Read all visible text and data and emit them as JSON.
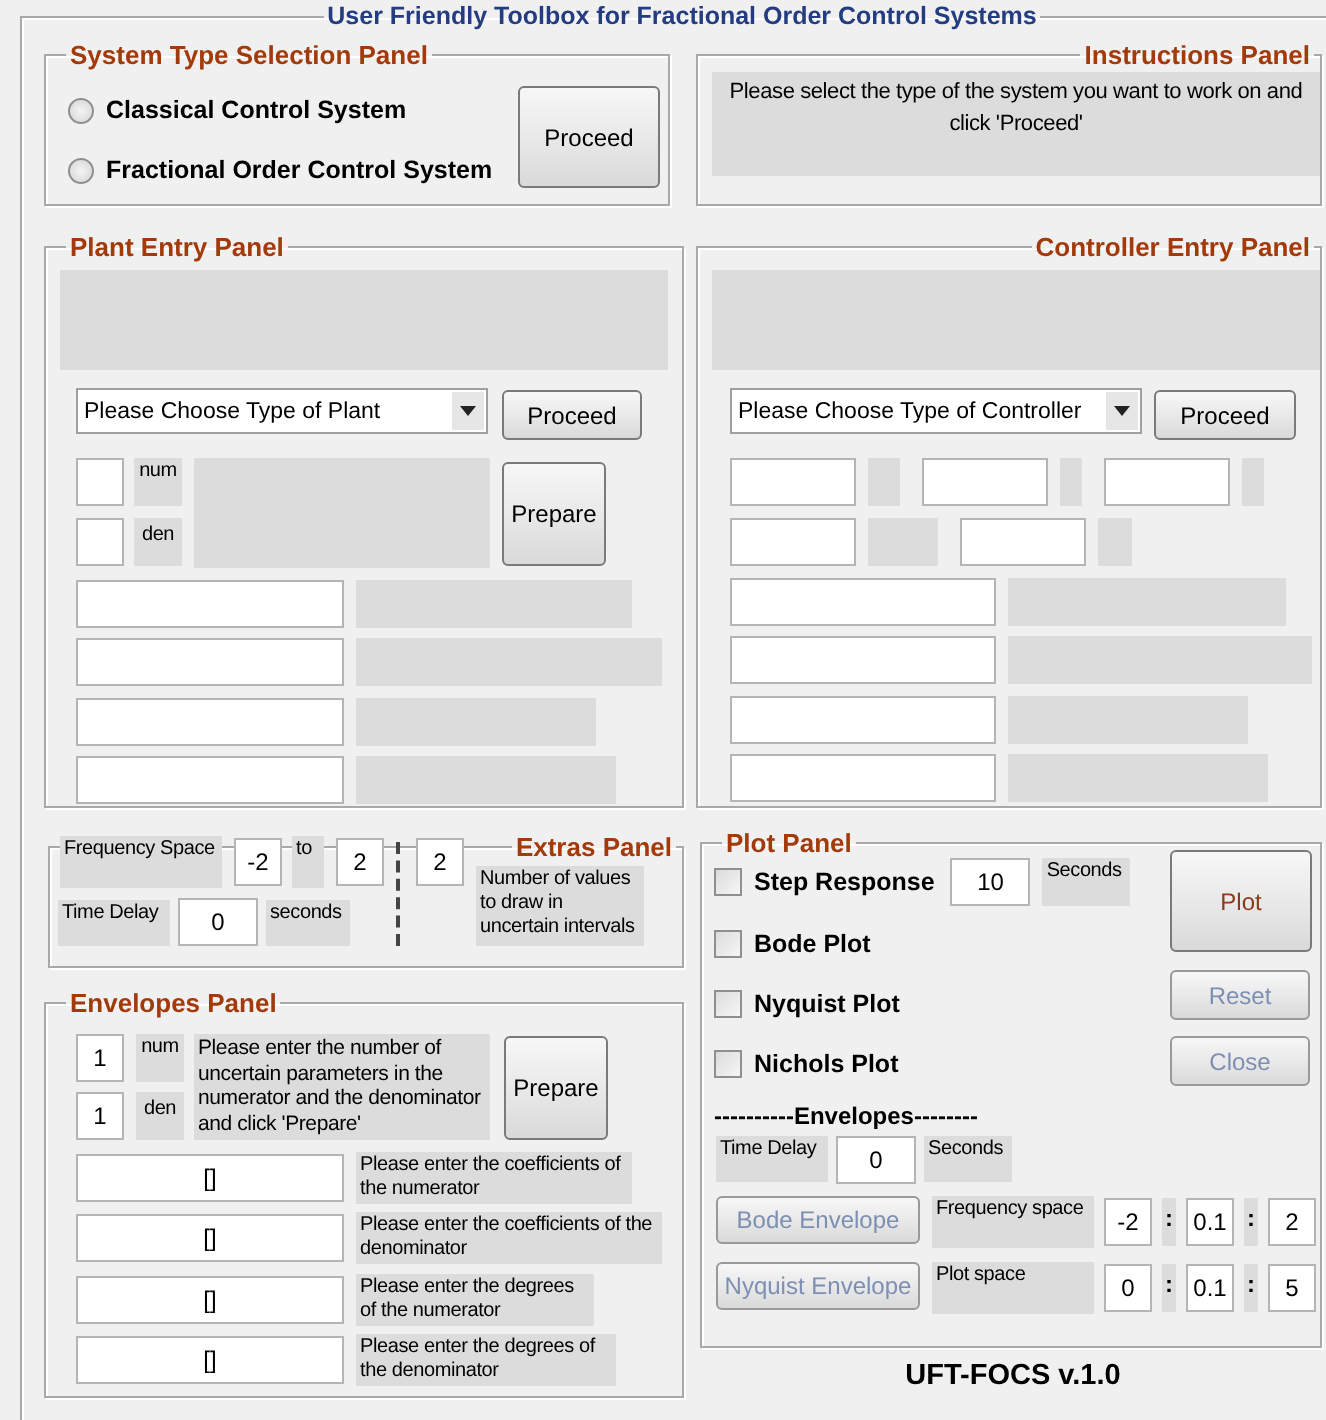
{
  "window": {
    "title": "User Friendly Toolbox for Fractional Order Control Systems"
  },
  "system_type_panel": {
    "title": "System Type Selection Panel",
    "options": [
      {
        "label": "Classical Control System",
        "selected": false
      },
      {
        "label": "Fractional Order Control System",
        "selected": false
      }
    ],
    "button": "Proceed"
  },
  "instructions_panel": {
    "title": "Instructions Panel",
    "text": "Please select the type of the system you want to work on and click 'Proceed'"
  },
  "plant_panel": {
    "title": "Plant Entry Panel",
    "dropdown": {
      "value": "Please Choose Type of Plant"
    },
    "proceed_button": "Proceed",
    "num_label": "num",
    "den_label": "den",
    "prepare_button": "Prepare"
  },
  "controller_panel": {
    "title": "Controller Entry Panel",
    "dropdown": {
      "value": "Please Choose Type of Controller"
    },
    "proceed_button": "Proceed"
  },
  "extras_panel": {
    "title": "Extras Panel",
    "frequency_label": "Frequency Space",
    "frequency_from": "-2",
    "to_label": "to",
    "frequency_to": "2",
    "time_delay_label": "Time Delay",
    "time_delay": "0",
    "seconds_label": "seconds",
    "value_count": "2",
    "value_count_label": "Number of values to draw in uncertain intervals"
  },
  "envelopes_panel": {
    "title": "Envelopes Panel",
    "num": "1",
    "num_label": "num",
    "den": "1",
    "den_label": "den",
    "instructions": "Please enter the number of uncertain parameters in the numerator and the denominator and click 'Prepare'",
    "prepare_button": "Prepare",
    "rows": [
      {
        "value": "[]",
        "label": "Please enter the coefficients of the numerator"
      },
      {
        "value": "[]",
        "label": "Please enter the coefficients of the denominator"
      },
      {
        "value": "[]",
        "label": "Please enter the degrees of the numerator"
      },
      {
        "value": "[]",
        "label": "Please enter the degrees of the denominator"
      }
    ]
  },
  "plot_panel": {
    "title": "Plot Panel",
    "plots": [
      {
        "label": "Step Response",
        "checked": false,
        "duration": "10",
        "unit": "Seconds"
      },
      {
        "label": "Bode Plot",
        "checked": false
      },
      {
        "label": "Nyquist Plot",
        "checked": false
      },
      {
        "label": "Nichols Plot",
        "checked": false
      }
    ],
    "buttons": [
      {
        "label": "Plot",
        "disabled": false,
        "color": "#8b3a1a"
      },
      {
        "label": "Reset",
        "disabled": true
      },
      {
        "label": "Close",
        "disabled": true
      }
    ],
    "envelopes_heading": "----------Envelopes--------",
    "time_delay_label": "Time Delay",
    "time_delay": "0",
    "seconds_label": "Seconds",
    "envelope_rows": [
      {
        "button": "Bode Envelope",
        "disabled": true,
        "label": "Frequency space",
        "values": [
          "-2",
          "0.1",
          "2"
        ],
        "separators": [
          ":",
          ":"
        ]
      },
      {
        "button": "Nyquist Envelope",
        "disabled": true,
        "label": "Plot space",
        "values": [
          "0",
          "0.1",
          "5"
        ],
        "separators": [
          ":",
          ":"
        ]
      }
    ]
  },
  "version": "UFT-FOCS v.1.0"
}
